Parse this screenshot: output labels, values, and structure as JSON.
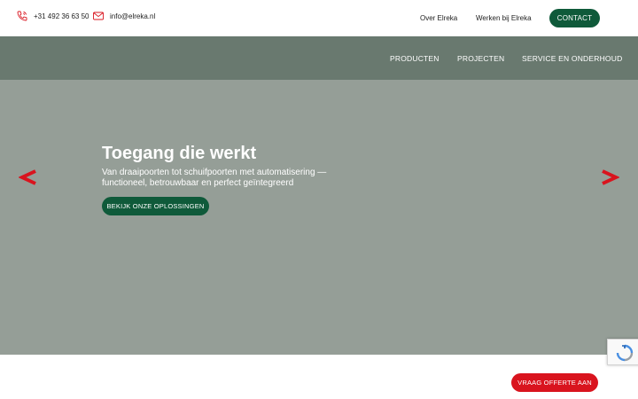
{
  "topbar": {
    "phone": {
      "icon": "phone-icon",
      "label": "+31 492 36 63 50"
    },
    "email": {
      "icon": "mail-icon",
      "label": "info@elreka.nl"
    },
    "links": [
      "Over Elreka",
      "Werken bij Elreka"
    ],
    "contact_label": "CONTACT"
  },
  "nav": {
    "items": [
      "PRODUCTEN",
      "PROJECTEN",
      "SERVICE EN ONDERHOUD"
    ]
  },
  "hero": {
    "title": "Toegang die werkt",
    "subtitle": "Van draaipoorten tot schuifpoorten met automatisering — functioneel, betrouwbaar en perfect geïntegreerd",
    "cta_label": "BEKIJK ONZE OPLOSSINGEN",
    "prev_icon": "chevron-left-icon",
    "next_icon": "chevron-right-icon"
  },
  "footer": {
    "quote_label": "VRAAG OFFERTE AAN",
    "recaptcha_icon": "recaptcha-icon"
  },
  "colors": {
    "brand_green": "#0f5a3a",
    "nav_bg": "#69796f",
    "hero_bg": "#959e97",
    "accent_red": "#d9141e"
  }
}
